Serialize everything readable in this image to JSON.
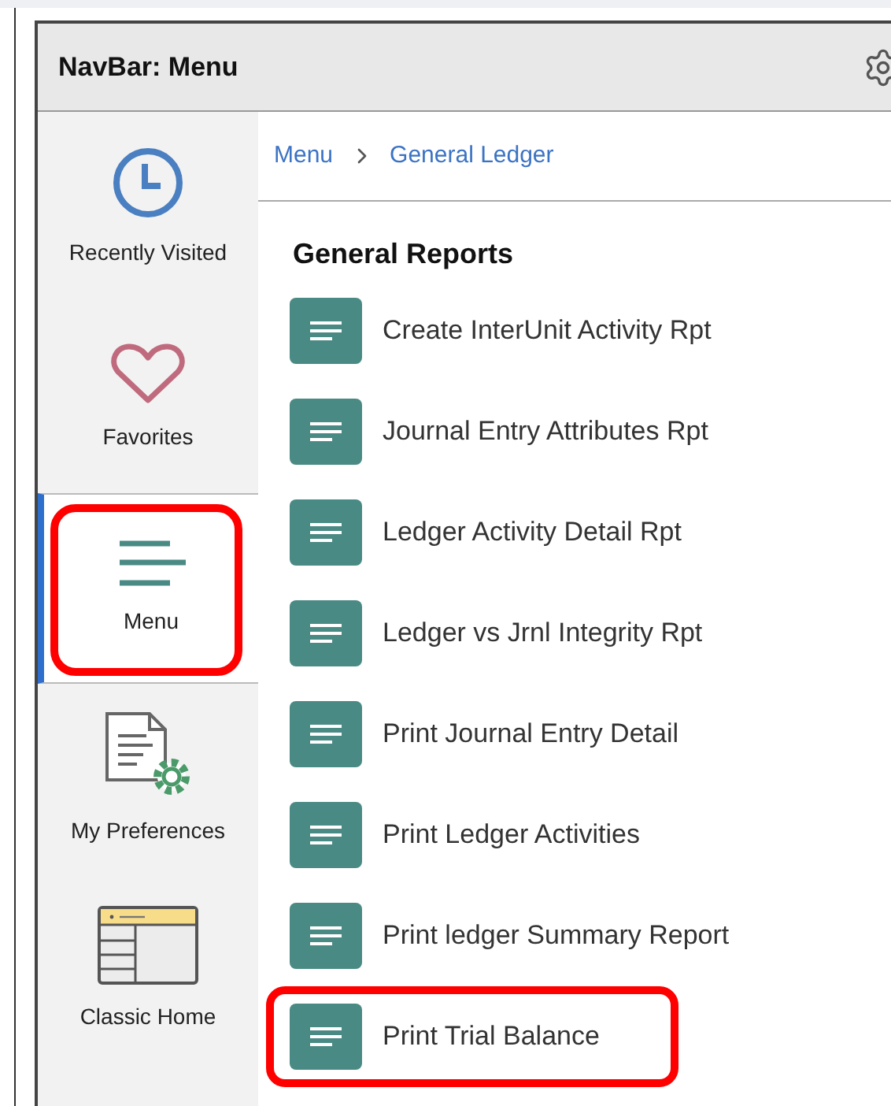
{
  "window": {
    "title": "NavBar: Menu"
  },
  "sidebar": {
    "items": [
      {
        "label": "Recently Visited",
        "kind": "clock",
        "selected": false,
        "highlighted": false
      },
      {
        "label": "Favorites",
        "kind": "heart",
        "selected": false,
        "highlighted": false
      },
      {
        "label": "Menu",
        "kind": "menu",
        "selected": true,
        "highlighted": true
      },
      {
        "label": "My Preferences",
        "kind": "preferences",
        "selected": false,
        "highlighted": false
      },
      {
        "label": "Classic Home",
        "kind": "classic",
        "selected": false,
        "highlighted": false
      }
    ]
  },
  "breadcrumb": [
    "Menu",
    "General Ledger"
  ],
  "section": {
    "title": "General Reports",
    "items": [
      {
        "label": "Create InterUnit Activity Rpt",
        "highlighted": false
      },
      {
        "label": "Journal Entry Attributes Rpt",
        "highlighted": false
      },
      {
        "label": "Ledger Activity Detail Rpt",
        "highlighted": false
      },
      {
        "label": "Ledger vs Jrnl Integrity Rpt",
        "highlighted": false
      },
      {
        "label": "Print Journal Entry Detail",
        "highlighted": false
      },
      {
        "label": "Print Ledger Activities",
        "highlighted": false
      },
      {
        "label": "Print ledger Summary Report",
        "highlighted": false
      },
      {
        "label": "Print Trial Balance",
        "highlighted": true
      }
    ]
  }
}
